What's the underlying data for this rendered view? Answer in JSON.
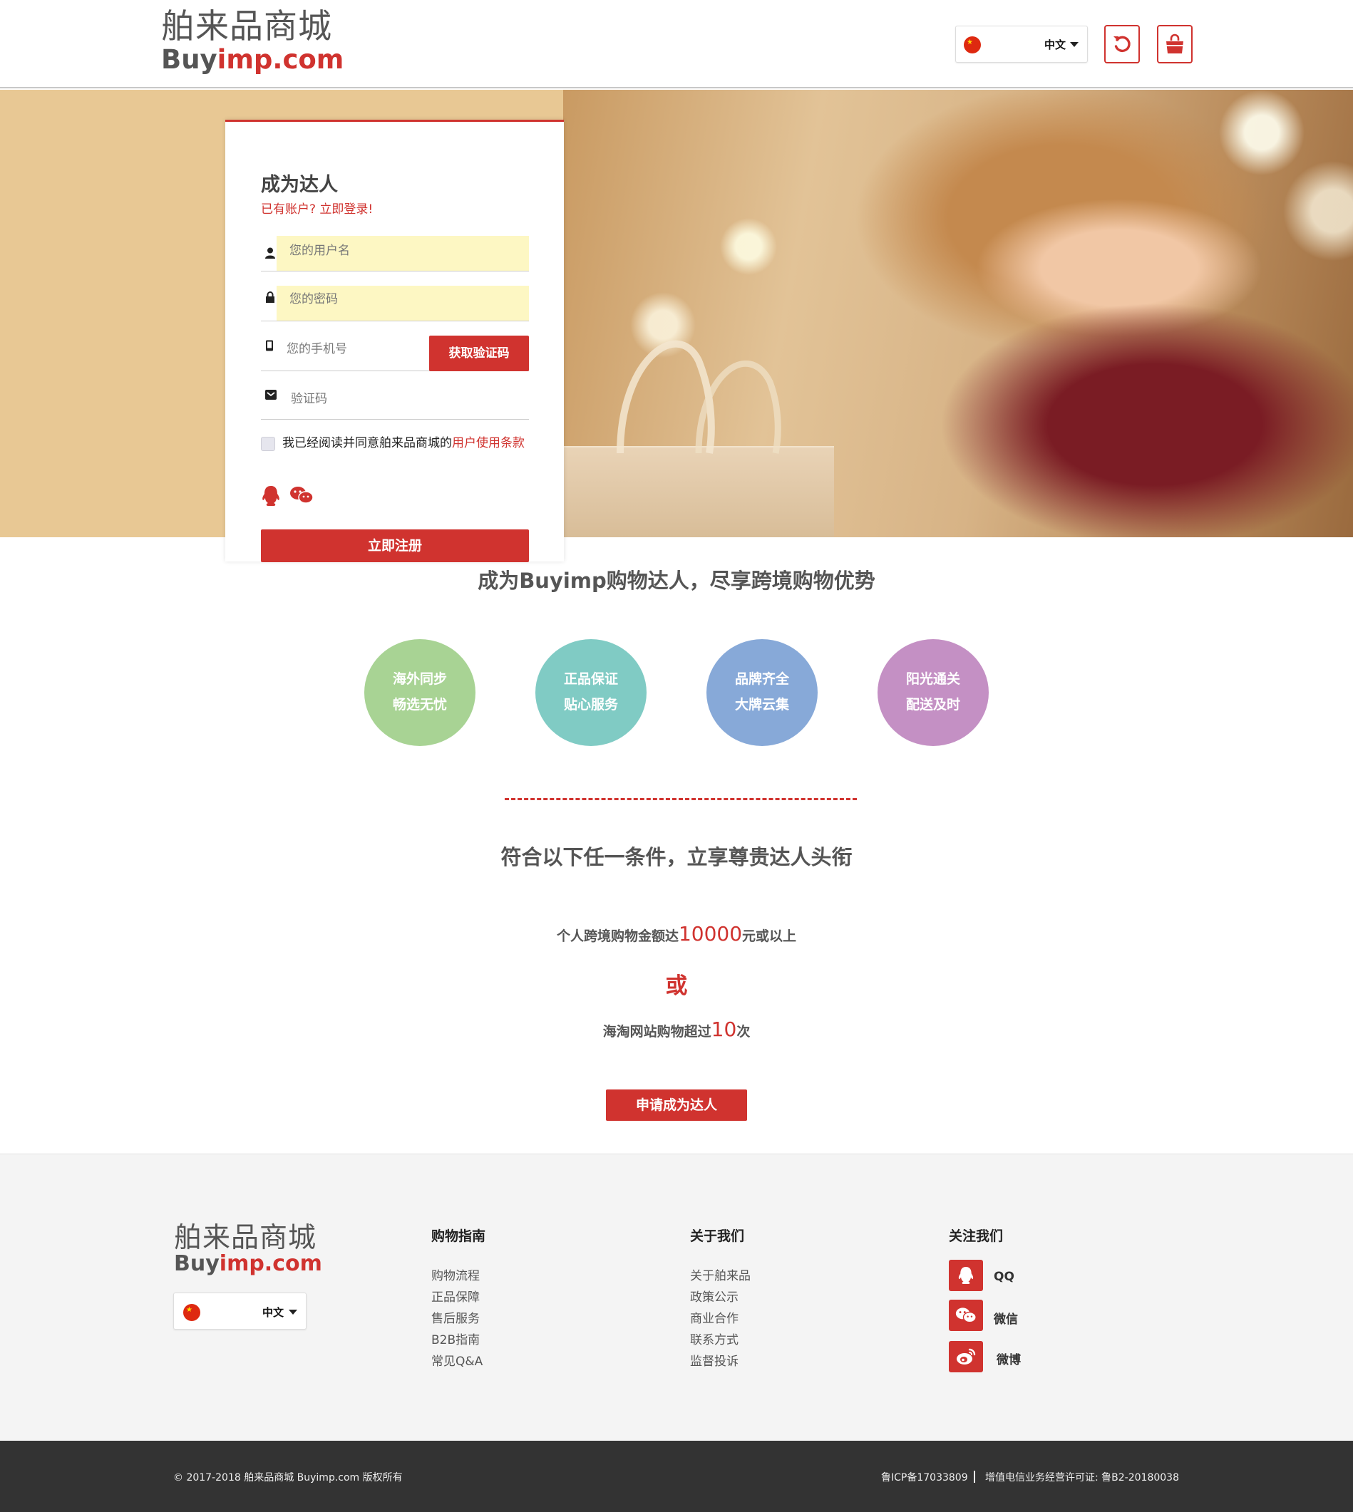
{
  "header": {
    "logo_cn": "舶来品商城",
    "logo_en_buy": "Buy",
    "logo_en_imp": "imp.com",
    "language": "中文",
    "refresh_icon": "refresh-icon",
    "cart_icon": "shopping-bag-icon"
  },
  "register": {
    "title": "成为达人",
    "login_link": "已有账户? 立即登录!",
    "username_placeholder": "您的用户名",
    "password_placeholder": "您的密码",
    "phone_placeholder": "您的手机号",
    "get_code_button": "获取验证码",
    "code_placeholder": "验证码",
    "agree_text": "我已经阅读并同意舶来品商城的",
    "terms_link": "用户使用条款",
    "submit_button": "立即注册"
  },
  "advantages": {
    "title": "成为Buyimp购物达人，尽享跨境购物优势",
    "items": [
      {
        "line1": "海外同步",
        "line2": "畅选无忧",
        "color": "#a8d394"
      },
      {
        "line1": "正品保证",
        "line2": "贴心服务",
        "color": "#80cbc4"
      },
      {
        "line1": "品牌齐全",
        "line2": "大牌云集",
        "color": "#87a9d8"
      },
      {
        "line1": "阳光通关",
        "line2": "配送及时",
        "color": "#c490c4"
      }
    ]
  },
  "conditions": {
    "title": "符合以下任一条件，立享尊贵达人头衔",
    "cond1_pre": "个人跨境购物金额达",
    "cond1_num": "10000",
    "cond1_post": "元或以上",
    "or_text": "或",
    "cond2_pre": "海淘网站购物超过",
    "cond2_num": "10",
    "cond2_post": "次",
    "apply_button": "申请成为达人"
  },
  "footer": {
    "language": "中文",
    "guide": {
      "title": "购物指南",
      "links": [
        "购物流程",
        "正品保障",
        "售后服务",
        "B2B指南",
        "常见Q&A"
      ]
    },
    "about": {
      "title": "关于我们",
      "links": [
        "关于舶来品",
        "政策公示",
        "商业合作",
        "联系方式",
        "监督投诉"
      ]
    },
    "follow": {
      "title": "关注我们",
      "items": [
        {
          "label": "QQ",
          "icon": "qq-icon"
        },
        {
          "label": "微信",
          "icon": "wechat-icon"
        },
        {
          "label": "微博",
          "icon": "weibo-icon"
        }
      ]
    },
    "copyright": "© 2017-2018 舶来品商城 Buyimp.com 版权所有",
    "icp": "鲁ICP备17033809",
    "license": "增值电信业务经营许可证: 鲁B2-20180038"
  },
  "colors": {
    "accent": "#d0332f",
    "hero_bg": "#e8c894",
    "footer_bg": "#f4f4f4",
    "bottom_bar": "#333333"
  }
}
